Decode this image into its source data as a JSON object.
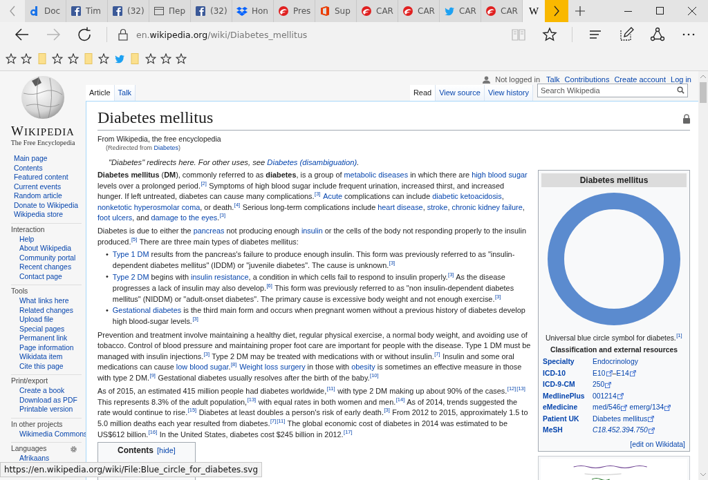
{
  "browser": {
    "tabs": [
      {
        "kind": "letter-logo",
        "label": "Doc",
        "selected": false
      },
      {
        "kind": "square-logo",
        "label": "Tim",
        "selected": false
      },
      {
        "kind": "square-logo",
        "label": "(32)",
        "selected": false
      },
      {
        "kind": "window",
        "label": "Пер",
        "selected": false
      },
      {
        "kind": "square-logo",
        "label": "(32)",
        "selected": false
      },
      {
        "kind": "box-logo",
        "label": "Hon",
        "selected": false
      },
      {
        "kind": "swirl",
        "label": "Pres",
        "selected": false
      },
      {
        "kind": "office",
        "label": "Sup",
        "selected": false
      },
      {
        "kind": "swirl",
        "label": "CAR",
        "selected": false
      },
      {
        "kind": "swirl",
        "label": "CAR",
        "selected": false
      },
      {
        "kind": "bird",
        "label": "CAR",
        "selected": false
      },
      {
        "kind": "swirl",
        "label": "CAR",
        "selected": false
      },
      {
        "kind": "text-logo",
        "label": "W",
        "selected": true
      }
    ],
    "nav_buttons": [
      {
        "kind": "back",
        "disabled": false
      },
      {
        "kind": "forward",
        "disabled": true
      },
      {
        "kind": "refresh",
        "disabled": false
      }
    ],
    "url_parts": [
      {
        "text": "en.",
        "emphasized": false
      },
      {
        "text": "wikipedia.org",
        "emphasized": true
      },
      {
        "text": "/wiki/Diabetes_mellitus",
        "emphasized": false
      }
    ],
    "page_buttons": [
      {
        "kind": "reading-view",
        "disabled": true
      },
      {
        "kind": "favorite",
        "disabled": false
      }
    ],
    "tool_buttons": [
      {
        "kind": "hub",
        "disabled": false
      },
      {
        "kind": "web-note",
        "disabled": false
      },
      {
        "kind": "share",
        "disabled": false
      },
      {
        "kind": "more",
        "disabled": false
      }
    ],
    "favorites": [
      {
        "kind": "star"
      },
      {
        "kind": "star"
      },
      {
        "kind": "folder"
      },
      {
        "kind": "star"
      },
      {
        "kind": "star"
      },
      {
        "kind": "folder"
      },
      {
        "kind": "star"
      },
      {
        "kind": "bird"
      },
      {
        "kind": "folder"
      },
      {
        "kind": "star"
      },
      {
        "kind": "star"
      },
      {
        "kind": "star"
      }
    ],
    "status_tooltip": "https://en.wikipedia.org/wiki/File:Blue_circle_for_diabetes.svg"
  },
  "sidebar": {
    "logo_title": "WIKIPEDIA",
    "logo_subtitle": "The Free Encyclopedia",
    "navigation": [
      "Main page",
      "Contents",
      "Featured content",
      "Current events",
      "Random article",
      "Donate to Wikipedia",
      "Wikipedia store"
    ],
    "sections": [
      {
        "heading": "Interaction",
        "settings": false,
        "items": [
          "Help",
          "About Wikipedia",
          "Community portal",
          "Recent changes",
          "Contact page"
        ]
      },
      {
        "heading": "Tools",
        "settings": false,
        "items": [
          "What links here",
          "Related changes",
          "Upload file",
          "Special pages",
          "Permanent link",
          "Page information",
          "Wikidata item",
          "Cite this page"
        ]
      },
      {
        "heading": "Print/export",
        "settings": false,
        "items": [
          "Create a book",
          "Download as PDF",
          "Printable version"
        ]
      },
      {
        "heading": "In other projects",
        "settings": false,
        "items": [
          "Wikimedia Commons"
        ]
      },
      {
        "heading": "Languages",
        "settings": true,
        "items": [
          "Afrikaans"
        ]
      }
    ]
  },
  "personal_bar": {
    "status": "Not logged in",
    "links": [
      "Talk",
      "Contributions",
      "Create account",
      "Log in"
    ]
  },
  "page_tabs": [
    {
      "label": "Article",
      "selected": true
    },
    {
      "label": "Talk",
      "selected": false
    }
  ],
  "view_tabs": [
    {
      "label": "Read",
      "selected": true
    },
    {
      "label": "View source",
      "selected": false
    },
    {
      "label": "View history",
      "selected": false
    }
  ],
  "search": {
    "placeholder": "Search Wikipedia"
  },
  "article": {
    "title": "Diabetes mellitus",
    "tagline": "From Wikipedia, the free encyclopedia",
    "redirect": [
      {
        "kind": "text",
        "text": "(Redirected from "
      },
      {
        "kind": "link",
        "text": "Diabetes"
      },
      {
        "kind": "text",
        "text": ")"
      }
    ],
    "hatnote": [
      {
        "kind": "text",
        "text": "\"Diabetes\" redirects here. For other uses, see "
      },
      {
        "kind": "link",
        "text": "Diabetes (disambiguation)"
      },
      {
        "kind": "text",
        "text": "."
      }
    ],
    "intro": [
      [
        {
          "kind": "bold",
          "text": "Diabetes mellitus"
        },
        {
          "kind": "text",
          "text": " ("
        },
        {
          "kind": "bold",
          "text": "DM"
        },
        {
          "kind": "text",
          "text": "), commonly referred to as "
        },
        {
          "kind": "bold",
          "text": "diabetes"
        },
        {
          "kind": "text",
          "text": ", is a group of "
        },
        {
          "kind": "link",
          "text": "metabolic diseases"
        },
        {
          "kind": "text",
          "text": " in which there are "
        },
        {
          "kind": "link",
          "text": "high blood sugar"
        },
        {
          "kind": "text",
          "text": " levels over a prolonged period."
        },
        {
          "kind": "ref",
          "text": "[2]"
        },
        {
          "kind": "text",
          "text": " Symptoms of high blood sugar include frequent urination, increased thirst, and increased hunger. If left untreated, diabetes can cause many complications."
        },
        {
          "kind": "ref",
          "text": "[3]"
        },
        {
          "kind": "link",
          "text": "Acute",
          "gap_before": true
        },
        {
          "kind": "text",
          "text": " complications can include "
        },
        {
          "kind": "link",
          "text": "diabetic ketoacidosis"
        },
        {
          "kind": "text",
          "text": ", "
        },
        {
          "kind": "link",
          "text": "nonketotic hyperosmolar coma"
        },
        {
          "kind": "text",
          "text": ", or death."
        },
        {
          "kind": "ref",
          "text": "[4]"
        },
        {
          "kind": "text",
          "text": " Serious long-term complications include "
        },
        {
          "kind": "link",
          "text": "heart disease"
        },
        {
          "kind": "text",
          "text": ", "
        },
        {
          "kind": "link",
          "text": "stroke"
        },
        {
          "kind": "text",
          "text": ", "
        },
        {
          "kind": "link",
          "text": "chronic kidney failure"
        },
        {
          "kind": "text",
          "text": ", "
        },
        {
          "kind": "link",
          "text": "foot ulcers"
        },
        {
          "kind": "text",
          "text": ", and "
        },
        {
          "kind": "link",
          "text": "damage to the eyes"
        },
        {
          "kind": "text",
          "text": "."
        },
        {
          "kind": "ref",
          "text": "[3]"
        }
      ],
      [
        {
          "kind": "text",
          "text": "Diabetes is due to either the "
        },
        {
          "kind": "link",
          "text": "pancreas"
        },
        {
          "kind": "text",
          "text": " not producing enough "
        },
        {
          "kind": "link",
          "text": "insulin"
        },
        {
          "kind": "text",
          "text": " or the cells of the body not responding properly to the insulin produced."
        },
        {
          "kind": "ref",
          "text": "[5]"
        },
        {
          "kind": "text",
          "text": " There are three main types of diabetes mellitus:"
        }
      ]
    ],
    "types": [
      {
        "marker": "•",
        "segments": [
          {
            "kind": "link",
            "text": "Type 1 DM"
          },
          {
            "kind": "text",
            "text": " results from the pancreas's failure to produce enough insulin. This form was previously referred to as \"insulin-dependent diabetes mellitus\" (IDDM) or \"juvenile diabetes\". The cause is unknown."
          },
          {
            "kind": "ref",
            "text": "[3]"
          }
        ]
      },
      {
        "marker": "•",
        "segments": [
          {
            "kind": "link",
            "text": "Type 2 DM"
          },
          {
            "kind": "text",
            "text": " begins with "
          },
          {
            "kind": "link",
            "text": "insulin resistance"
          },
          {
            "kind": "text",
            "text": ", a condition in which cells fail to respond to insulin properly."
          },
          {
            "kind": "ref",
            "text": "[3]"
          },
          {
            "kind": "text",
            "text": " As the disease progresses a lack of insulin may also develop."
          },
          {
            "kind": "ref",
            "text": "[6]"
          },
          {
            "kind": "text",
            "text": " This form was previously referred to as \"non insulin-dependent diabetes mellitus\" (NIDDM) or \"adult-onset diabetes\". The primary cause is excessive body weight and not enough exercise."
          },
          {
            "kind": "ref",
            "text": "[3]"
          }
        ]
      },
      {
        "marker": "•",
        "segments": [
          {
            "kind": "link",
            "text": "Gestational diabetes"
          },
          {
            "kind": "text",
            "text": " is the third main form and occurs when pregnant women without a previous history of diabetes develop high blood-sugar levels."
          },
          {
            "kind": "ref",
            "text": "[3]"
          }
        ]
      }
    ],
    "body": [
      [
        {
          "kind": "text",
          "text": "Prevention and treatment involve maintaining a healthy diet, regular physical exercise, a normal body weight, and avoiding use of tobacco. Control of blood pressure and maintaining proper foot care are important for people with the disease. Type 1 DM must be managed with insulin injections."
        },
        {
          "kind": "ref",
          "text": "[3]"
        },
        {
          "kind": "text",
          "text": " Type 2 DM may be treated with medications with or without insulin."
        },
        {
          "kind": "ref",
          "text": "[7]"
        },
        {
          "kind": "text",
          "text": " Insulin and some oral medications can cause "
        },
        {
          "kind": "link",
          "text": "low blood sugar"
        },
        {
          "kind": "text",
          "text": "."
        },
        {
          "kind": "ref",
          "text": "[8]"
        },
        {
          "kind": "link",
          "text": "Weight loss surgery",
          "gap_before": true
        },
        {
          "kind": "text",
          "text": " in those with "
        },
        {
          "kind": "link",
          "text": "obesity"
        },
        {
          "kind": "text",
          "text": " is sometimes an effective measure in those with type 2 DM."
        },
        {
          "kind": "ref",
          "text": "[9]"
        },
        {
          "kind": "text",
          "text": " Gestational diabetes usually resolves after the birth of the baby."
        },
        {
          "kind": "ref",
          "text": "[10]"
        }
      ],
      [
        {
          "kind": "text",
          "text": "As of 2015, an estimated 415 million people had diabetes worldwide,"
        },
        {
          "kind": "ref",
          "text": "[11]"
        },
        {
          "kind": "text",
          "text": " with type 2 DM making up about 90% of the cases."
        },
        {
          "kind": "ref",
          "text": "[12]"
        },
        {
          "kind": "ref",
          "text": "[13]"
        },
        {
          "kind": "text",
          "text": " This represents 8.3% of the adult population,"
        },
        {
          "kind": "ref",
          "text": "[13]"
        },
        {
          "kind": "text",
          "text": " with equal rates in both women and men."
        },
        {
          "kind": "ref",
          "text": "[14]"
        },
        {
          "kind": "text",
          "text": " As of 2014, trends suggested the rate would continue to rise."
        },
        {
          "kind": "ref",
          "text": "[15]"
        },
        {
          "kind": "text",
          "text": " Diabetes at least doubles a person's risk of early death."
        },
        {
          "kind": "ref",
          "text": "[3]"
        },
        {
          "kind": "text",
          "text": " From 2012 to 2015, approximately 1.5 to 5.0 million deaths each year resulted from diabetes."
        },
        {
          "kind": "ref",
          "text": "[7]"
        },
        {
          "kind": "ref",
          "text": "[11]"
        },
        {
          "kind": "text",
          "text": " The global economic cost of diabetes in 2014 was estimated to be US$612 billion."
        },
        {
          "kind": "ref",
          "text": "[16]"
        },
        {
          "kind": "text",
          "text": " In the United States, diabetes cost $245 billion in 2012."
        },
        {
          "kind": "ref",
          "text": "[17]"
        }
      ]
    ],
    "contents": {
      "title": "Contents",
      "toggle": "[hide]"
    }
  },
  "infobox": {
    "title": "Diabetes mellitus",
    "caption": [
      {
        "kind": "text",
        "text": "Universal blue circle symbol for diabetes."
      },
      {
        "kind": "ref",
        "text": "[1]"
      }
    ],
    "subheader": "Classification and external resources",
    "rows": [
      {
        "label": "Specialty",
        "italic": false,
        "parts": [
          {
            "kind": "link",
            "text": "Endocrinology"
          }
        ]
      },
      {
        "label": "ICD-10",
        "italic": false,
        "parts": [
          {
            "kind": "ext-link",
            "text": "E10"
          },
          {
            "kind": "text",
            "text": "–"
          },
          {
            "kind": "ext-link",
            "text": "E14"
          }
        ]
      },
      {
        "label": "ICD-9-CM",
        "italic": false,
        "parts": [
          {
            "kind": "ext-link",
            "text": "250"
          }
        ]
      },
      {
        "label": "MedlinePlus",
        "italic": false,
        "parts": [
          {
            "kind": "ext-link",
            "text": "001214"
          }
        ]
      },
      {
        "label": "eMedicine",
        "italic": false,
        "parts": [
          {
            "kind": "ext-link",
            "text": "med/546"
          },
          {
            "kind": "ext-link",
            "text": "emerg/134",
            "gap_before": true
          }
        ]
      },
      {
        "label": "Patient UK",
        "italic": false,
        "parts": [
          {
            "kind": "ext-link",
            "text": "Diabetes mellitus"
          }
        ]
      },
      {
        "label": "MeSH",
        "italic": true,
        "parts": [
          {
            "kind": "ext-link",
            "text": "C18.452.394.750"
          }
        ]
      }
    ],
    "edit_link": "[edit on Wikidata]"
  }
}
